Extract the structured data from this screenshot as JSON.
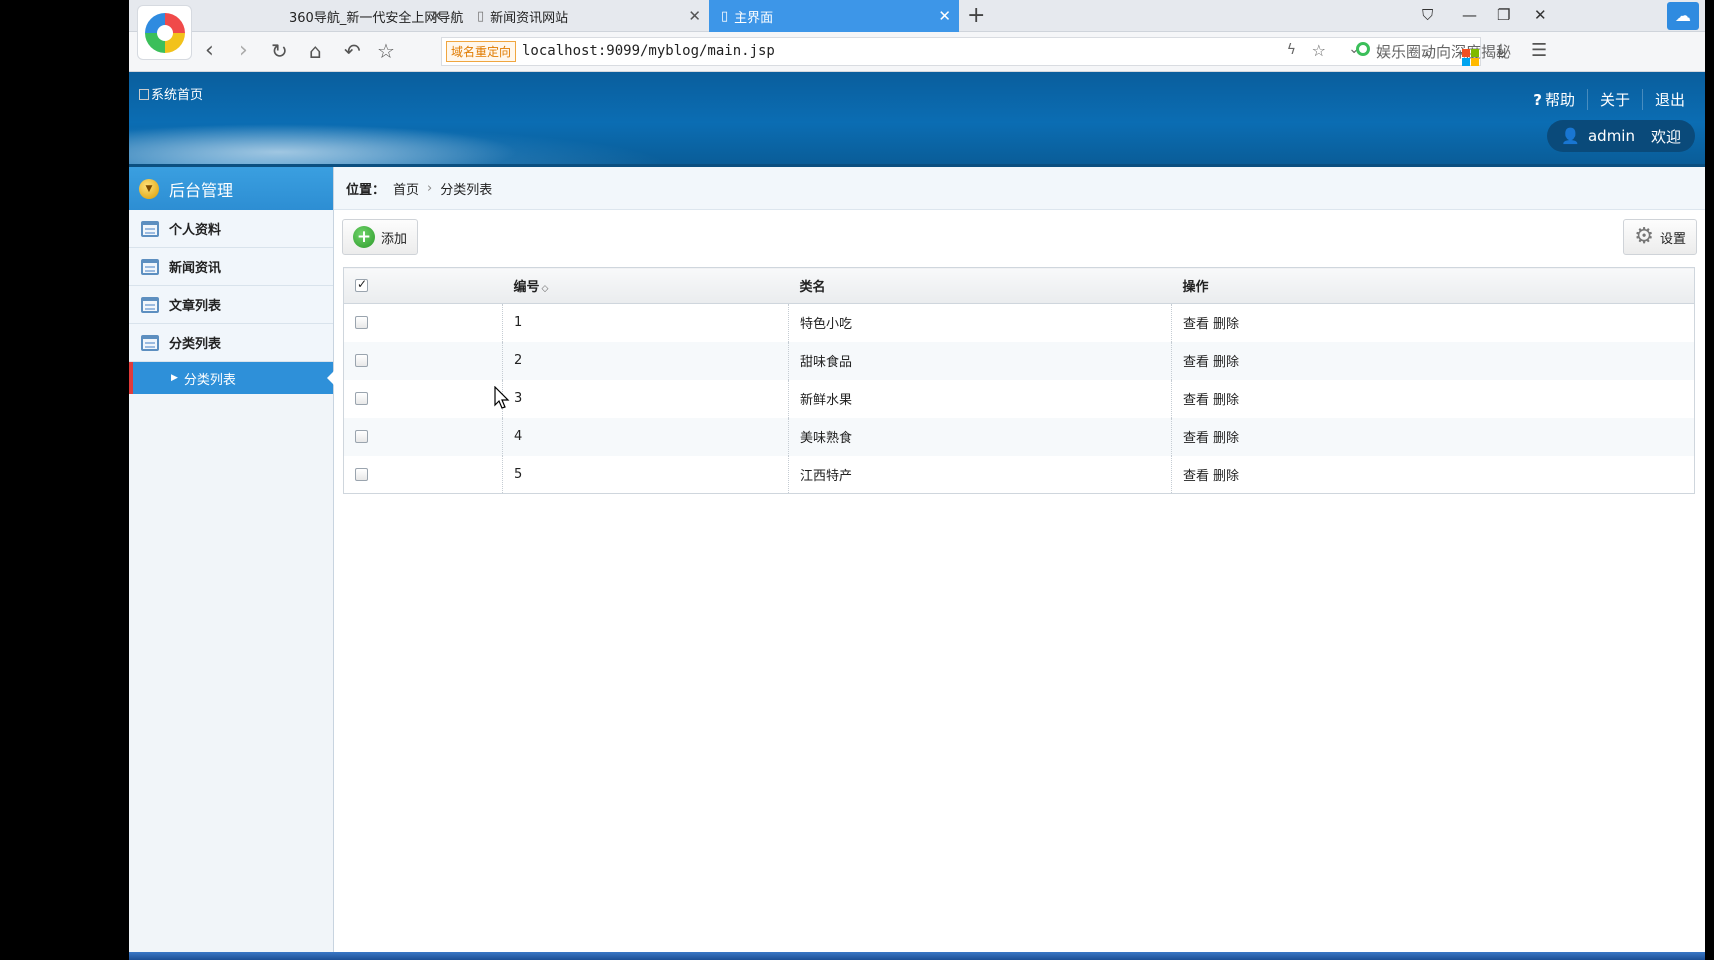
{
  "browser": {
    "tabs": [
      {
        "label": "360导航_新一代安全上网导航"
      },
      {
        "label": "新闻资讯网站"
      },
      {
        "label": "主界面"
      }
    ],
    "redirect_badge": "域名重定向",
    "url": "localhost:9099/myblog/main.jsp",
    "search_text": "娱乐圈动向深度揭秘"
  },
  "header": {
    "logo_alt": "系统首页",
    "links": {
      "help": "帮助",
      "about": "关于",
      "logout": "退出"
    },
    "user": "admin",
    "welcome": "欢迎"
  },
  "sidebar": {
    "title": "后台管理",
    "items": [
      {
        "label": "个人资料"
      },
      {
        "label": "新闻资讯"
      },
      {
        "label": "文章列表"
      },
      {
        "label": "分类列表"
      }
    ],
    "active_sub": "分类列表"
  },
  "breadcrumb": {
    "label": "位置：",
    "home": "首页",
    "current": "分类列表"
  },
  "toolbar": {
    "add": "添加",
    "settings": "设置"
  },
  "table": {
    "headers": {
      "id": "编号",
      "name": "类名",
      "ops": "操作"
    },
    "rows": [
      {
        "id": "1",
        "name": "特色小吃",
        "view": "查看",
        "del": "删除"
      },
      {
        "id": "2",
        "name": "甜味食品",
        "view": "查看",
        "del": "删除"
      },
      {
        "id": "3",
        "name": "新鲜水果",
        "view": "查看",
        "del": "删除"
      },
      {
        "id": "4",
        "name": "美味熟食",
        "view": "查看",
        "del": "删除"
      },
      {
        "id": "5",
        "name": "江西特产",
        "view": "查看",
        "del": "删除"
      }
    ]
  },
  "colors": {
    "accent": "#2e90d9",
    "header": "#0b6db3",
    "active_tab": "#3d96e8"
  }
}
